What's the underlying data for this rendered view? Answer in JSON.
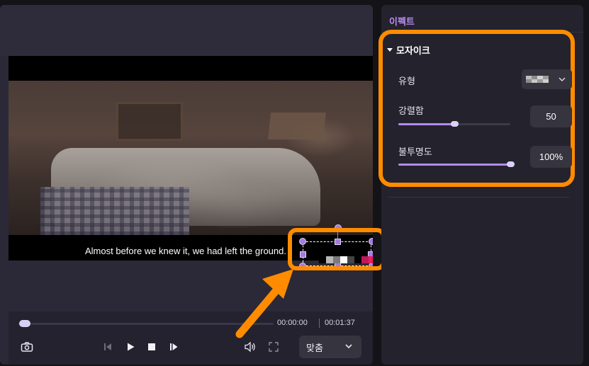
{
  "player": {
    "subtitle": "Almost before we knew it, we had left the ground.",
    "mosaic_cells": [
      "#000000",
      "#b7b7b7",
      "#7a7a7a",
      "#ffffff",
      "#444444",
      "#000000",
      "#c2185b",
      "#e91e63"
    ],
    "progress_fraction": 0.0,
    "time_current": "00:00:00",
    "time_total": "00:01:37",
    "fit_label": "맞춤",
    "icons": {
      "snapshot": "camera-icon",
      "prev_frame": "step-backward-icon",
      "play": "play-icon",
      "stop": "stop-icon",
      "next_frame": "step-forward-icon",
      "volume": "speaker-icon",
      "fullscreen": "fullscreen-icon",
      "dropdown": "chevron-down-icon"
    }
  },
  "effects": {
    "tab_label": "이펙트",
    "section_title": "모자이크",
    "type_label": "유형",
    "strength_label": "강렬함",
    "strength_value": "50",
    "strength_fraction": 0.5,
    "opacity_label": "불투명도",
    "opacity_value": "100%",
    "opacity_fraction": 1.0
  },
  "colors": {
    "accent": "#b98cf2",
    "highlight": "#ff8c00",
    "panel": "#24222d"
  }
}
